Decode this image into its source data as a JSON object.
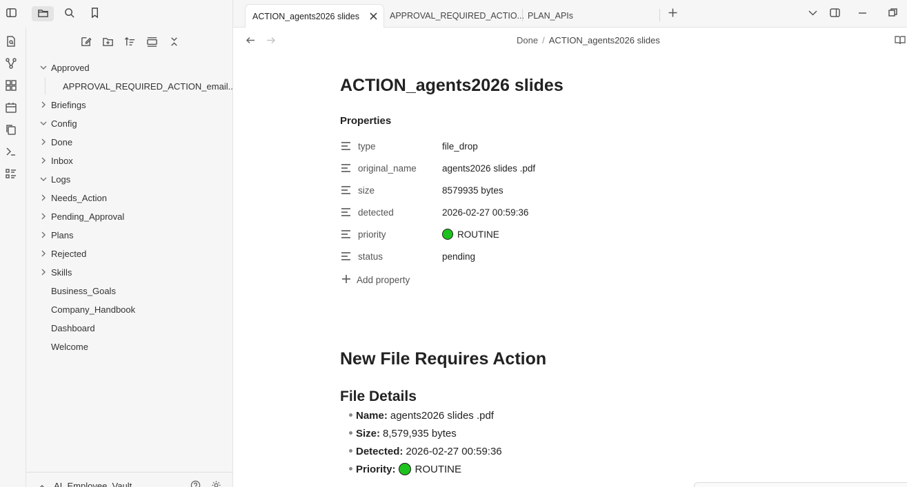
{
  "sidebar": {
    "tree": [
      {
        "label": "Approved",
        "expanded": true
      },
      {
        "label": "APPROVAL_REQUIRED_ACTION_email...",
        "nested": true
      },
      {
        "label": "Briefings",
        "expanded": false
      },
      {
        "label": "Config",
        "expanded": true
      },
      {
        "label": "Done",
        "expanded": false
      },
      {
        "label": "Inbox",
        "expanded": false
      },
      {
        "label": "Logs",
        "expanded": true
      },
      {
        "label": "Needs_Action",
        "expanded": false
      },
      {
        "label": "Pending_Approval",
        "expanded": false
      },
      {
        "label": "Plans",
        "expanded": false
      },
      {
        "label": "Rejected",
        "expanded": false
      },
      {
        "label": "Skills",
        "expanded": false
      },
      {
        "label": "Business_Goals",
        "file": true
      },
      {
        "label": "Company_Handbook",
        "file": true
      },
      {
        "label": "Dashboard",
        "file": true
      },
      {
        "label": "Welcome",
        "file": true
      }
    ],
    "vault_name": "AI_Employee_Vault"
  },
  "tabs": [
    {
      "label": "ACTION_agents2026 slides",
      "active": true
    },
    {
      "label": "APPROVAL_REQUIRED_ACTIO...",
      "active": false
    },
    {
      "label": "PLAN_APIs",
      "active": false
    }
  ],
  "breadcrumb": {
    "folder": "Done",
    "separator": "/",
    "current": "ACTION_agents2026 slides"
  },
  "note": {
    "title": "ACTION_agents2026 slides",
    "properties_heading": "Properties",
    "properties": [
      {
        "key": "type",
        "value": "file_drop"
      },
      {
        "key": "original_name",
        "value": "agents2026 slides .pdf"
      },
      {
        "key": "size",
        "value": "8579935 bytes"
      },
      {
        "key": "detected",
        "value": "2026-02-27 00:59:36"
      },
      {
        "key": "priority",
        "value": "ROUTINE",
        "dot": true
      },
      {
        "key": "status",
        "value": "pending"
      }
    ],
    "add_property": "Add property",
    "heading1": "New File Requires Action",
    "heading2": "File Details",
    "details": [
      {
        "label": "Name:",
        "value": "agents2026 slides .pdf"
      },
      {
        "label": "Size:",
        "value": "8,579,935 bytes"
      },
      {
        "label": "Detected:",
        "value": "2026-02-27 00:59:36"
      },
      {
        "label": "Priority:",
        "value": "ROUTINE",
        "dot": true
      }
    ]
  },
  "colors": {
    "accent_dot": "#1ec21e",
    "sidebar_bg": "#f6f6f6"
  }
}
